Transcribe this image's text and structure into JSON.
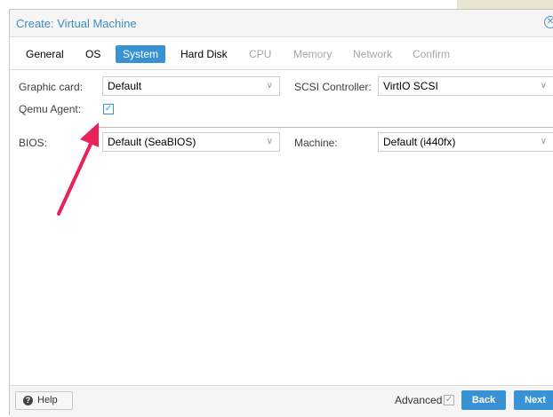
{
  "window": {
    "title": "Create: Virtual Machine",
    "close_icon": "close-circle-icon"
  },
  "tabs": [
    {
      "label": "General",
      "state": "enabled"
    },
    {
      "label": "OS",
      "state": "enabled"
    },
    {
      "label": "System",
      "state": "active"
    },
    {
      "label": "Hard Disk",
      "state": "enabled"
    },
    {
      "label": "CPU",
      "state": "disabled"
    },
    {
      "label": "Memory",
      "state": "disabled"
    },
    {
      "label": "Network",
      "state": "disabled"
    },
    {
      "label": "Confirm",
      "state": "disabled"
    }
  ],
  "form": {
    "graphic_card": {
      "label": "Graphic card:",
      "value": "Default"
    },
    "scsi_controller": {
      "label": "SCSI Controller:",
      "value": "VirtIO SCSI"
    },
    "qemu_agent": {
      "label": "Qemu Agent:",
      "checked": true
    },
    "bios": {
      "label": "BIOS:",
      "value": "Default (SeaBIOS)"
    },
    "machine": {
      "label": "Machine:",
      "value": "Default (i440fx)"
    }
  },
  "footer": {
    "help_label": "Help",
    "advanced_label": "Advanced",
    "advanced_checked": true,
    "back_label": "Back",
    "next_label": "Next"
  },
  "colors": {
    "accent": "#3892d4",
    "title": "#3c8dbc",
    "annotation_arrow": "#e8235a"
  }
}
